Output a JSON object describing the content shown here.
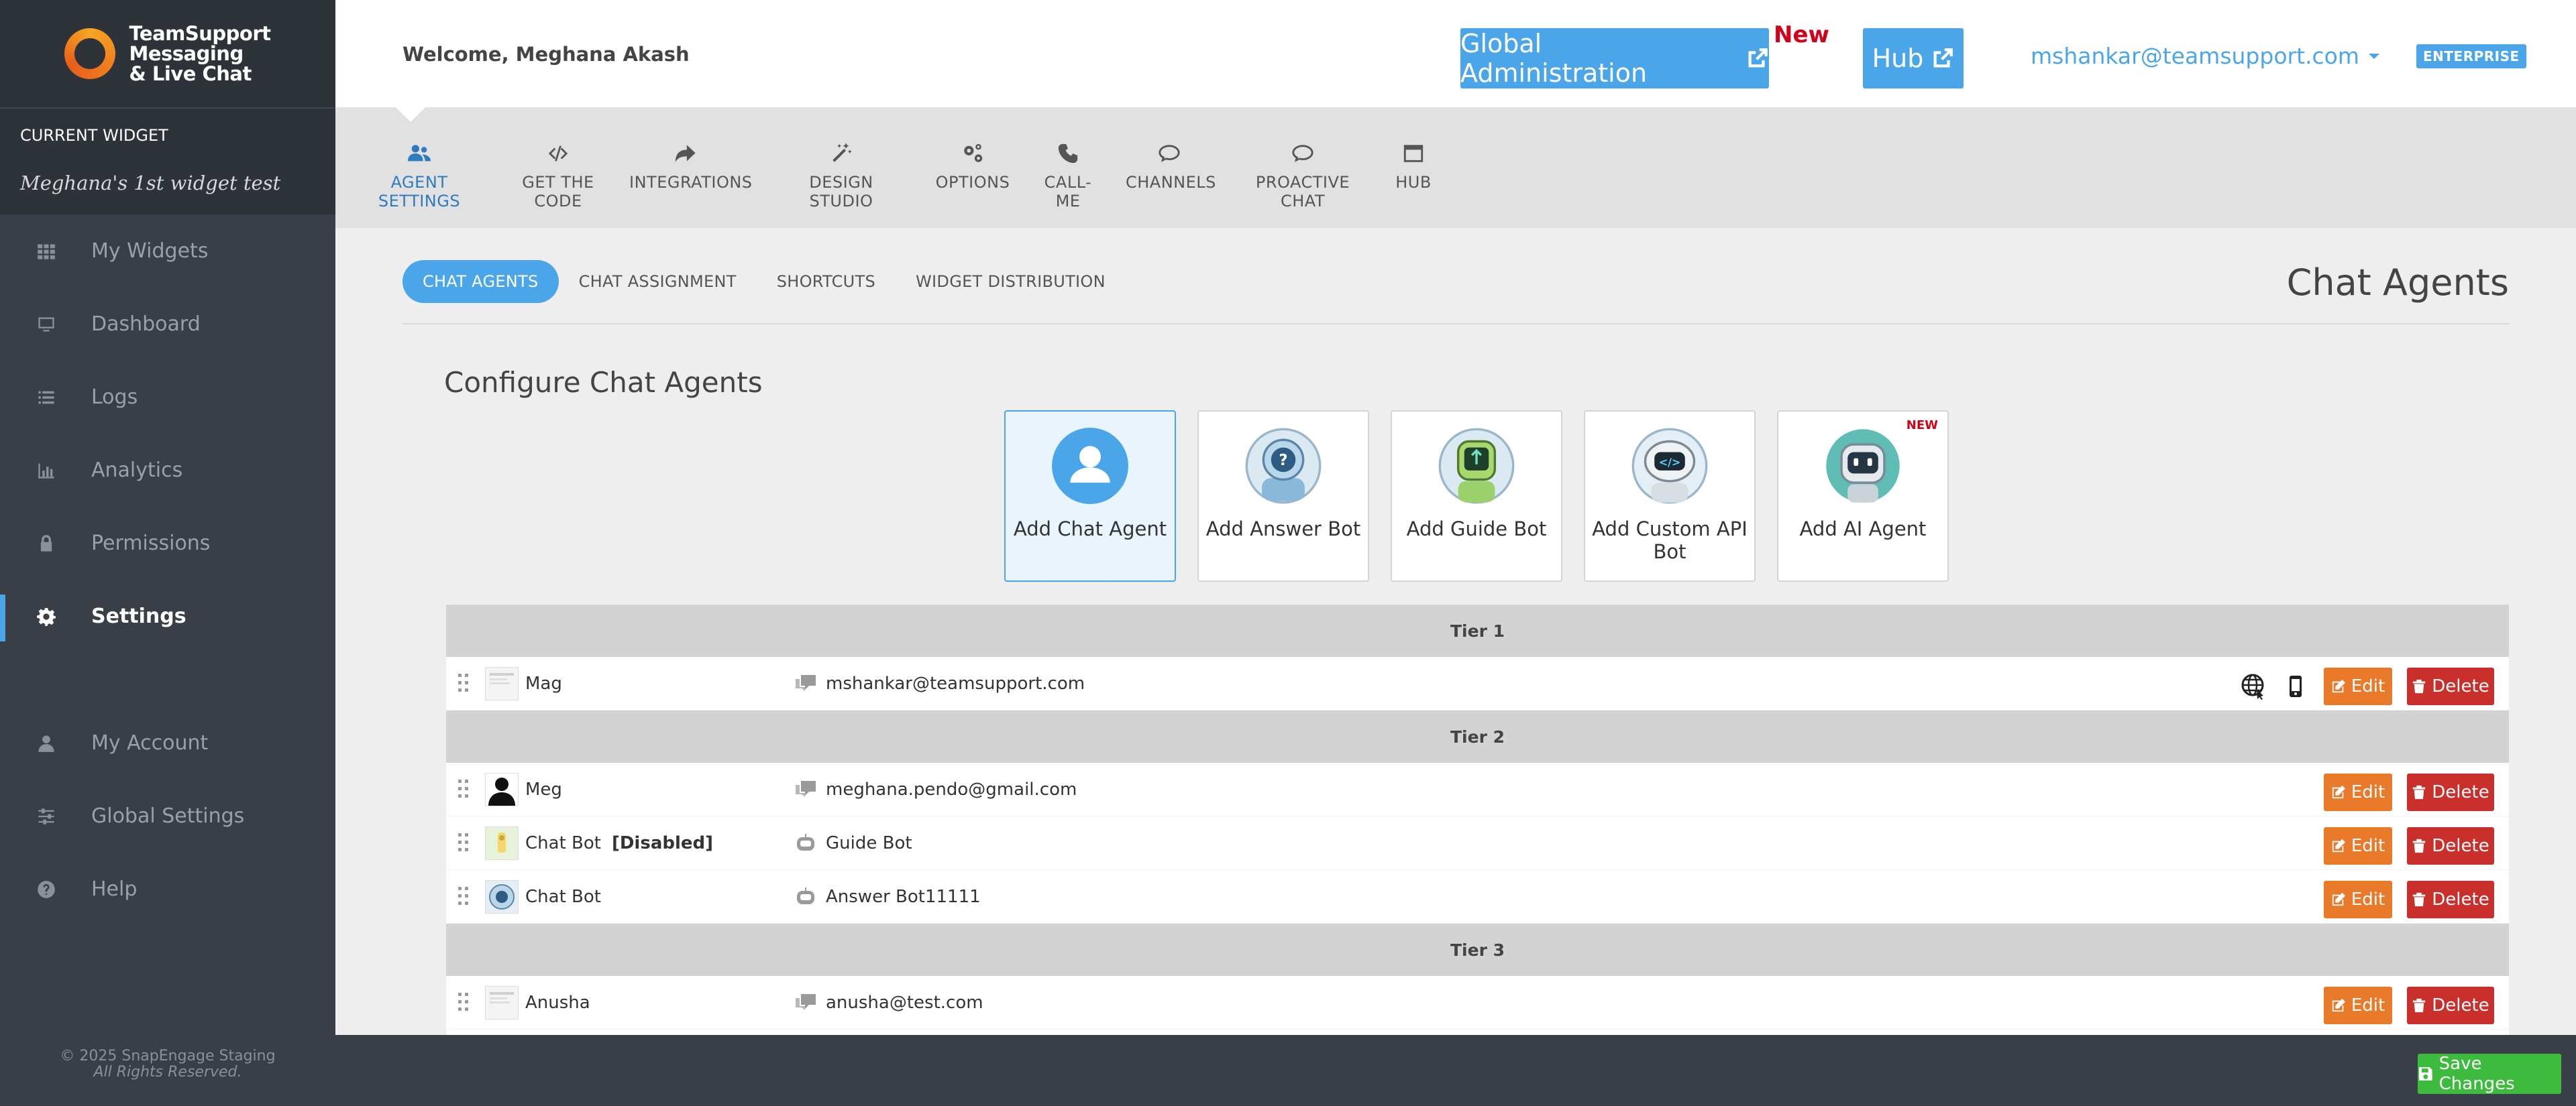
{
  "brand": {
    "line1": "TeamSupport",
    "line2": "Messaging",
    "line3": "& Live Chat"
  },
  "current_widget": {
    "label": "CURRENT WIDGET",
    "name": "Meghana's 1st widget test"
  },
  "sidebar": {
    "items": [
      {
        "label": "My Widgets",
        "icon": "grid-icon"
      },
      {
        "label": "Dashboard",
        "icon": "monitor-icon"
      },
      {
        "label": "Logs",
        "icon": "list-icon"
      },
      {
        "label": "Analytics",
        "icon": "bar-chart-icon"
      },
      {
        "label": "Permissions",
        "icon": "lock-icon"
      },
      {
        "label": "Settings",
        "icon": "gear-icon",
        "active": true
      }
    ],
    "items2": [
      {
        "label": "My Account",
        "icon": "user-icon"
      },
      {
        "label": "Global Settings",
        "icon": "sliders-icon"
      },
      {
        "label": "Help",
        "icon": "question-icon"
      }
    ],
    "footer": {
      "copyright": "© 2025 SnapEngage Staging",
      "rights": "All Rights Reserved."
    }
  },
  "header": {
    "welcome": "Welcome, Meghana Akash",
    "global_admin_label": "Global Administration",
    "new_label": "New",
    "hub_label": "Hub",
    "user_email": "mshankar@teamsupport.com",
    "plan_badge": "ENTERPRISE"
  },
  "topnav": {
    "items": [
      {
        "label": "AGENT SETTINGS",
        "icon": "users-icon",
        "active": true
      },
      {
        "label": "GET THE CODE",
        "icon": "code-icon"
      },
      {
        "label": "INTEGRATIONS",
        "icon": "share-icon"
      },
      {
        "label": "DESIGN STUDIO",
        "icon": "magic-wand-icon"
      },
      {
        "label": "OPTIONS",
        "icon": "cogs-icon"
      },
      {
        "label": "CALL-ME",
        "icon": "phone-icon"
      },
      {
        "label": "CHANNELS",
        "icon": "chat-icon"
      },
      {
        "label": "PROACTIVE CHAT",
        "icon": "comment-icon"
      },
      {
        "label": "HUB",
        "icon": "window-icon"
      }
    ]
  },
  "subtabs": {
    "items": [
      "CHAT AGENTS",
      "CHAT ASSIGNMENT",
      "SHORTCUTS",
      "WIDGET DISTRIBUTION"
    ]
  },
  "page_title": "Chat Agents",
  "config_title": "Configure Chat Agents",
  "cards": [
    {
      "label": "Add Chat Agent"
    },
    {
      "label": "Add Answer Bot"
    },
    {
      "label": "Add Guide Bot"
    },
    {
      "label": "Add Custom API Bot"
    },
    {
      "label": "Add AI Agent",
      "badge": "NEW"
    }
  ],
  "table": {
    "tiers": [
      "Tier 1",
      "Tier 2",
      "Tier 3"
    ],
    "rows": [
      {
        "name": "Mag",
        "status": "",
        "contact": "mshankar@teamsupport.com"
      },
      {
        "name": "Meg",
        "status": "",
        "contact": "meghana.pendo@gmail.com"
      },
      {
        "name": "Chat Bot",
        "status": "[Disabled]",
        "contact": "Guide Bot"
      },
      {
        "name": "Chat Bot",
        "status": "",
        "contact": "Answer Bot11111"
      },
      {
        "name": "Anusha",
        "status": "",
        "contact": "anusha@test.com"
      }
    ],
    "edit_label": "Edit",
    "delete_label": "Delete"
  },
  "save_label": "Save Changes",
  "colors": {
    "accent": "#4aa6e8",
    "edit": "#e87a2a",
    "delete": "#c9302c",
    "save": "#3dbb3d",
    "new_red": "#d0021b"
  }
}
